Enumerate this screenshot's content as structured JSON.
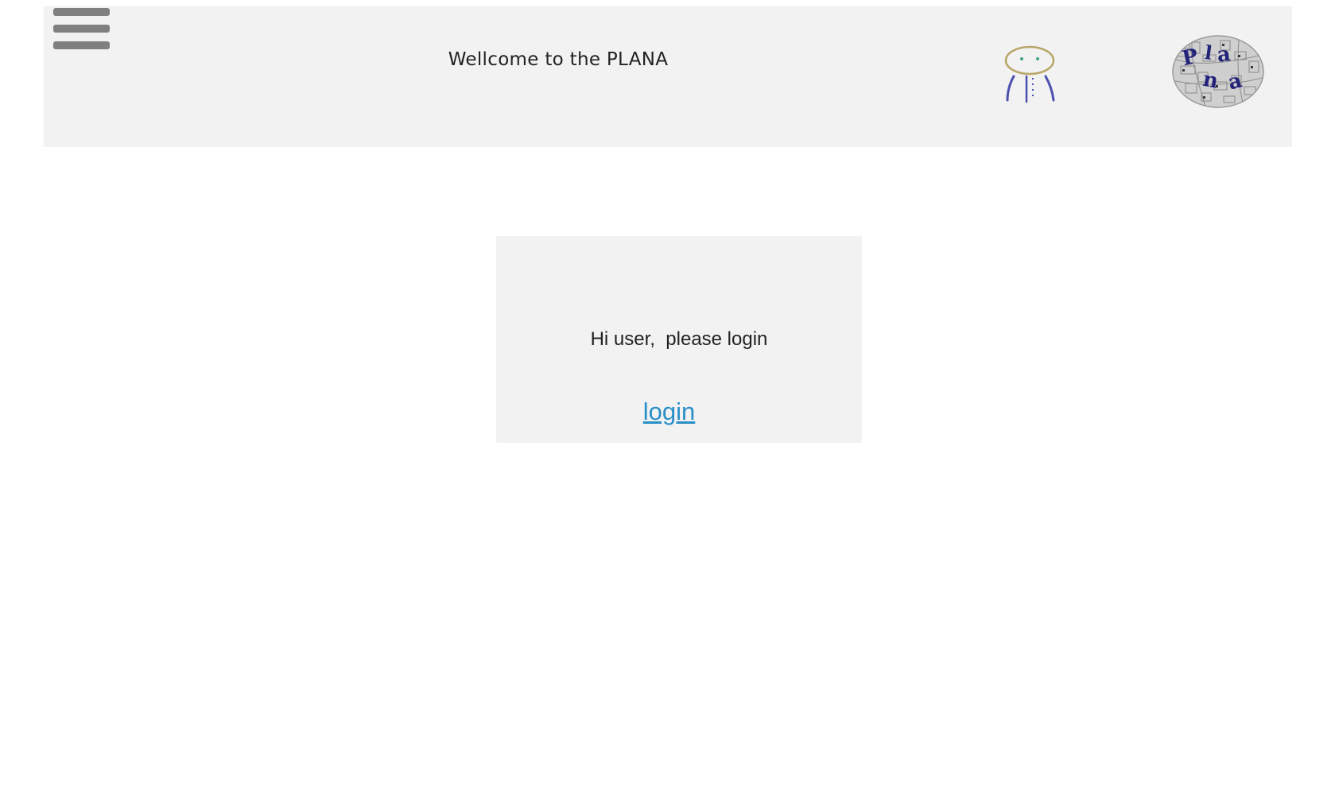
{
  "header": {
    "title": "Wellcome to the PLANA",
    "menu_icon": "hamburger-menu-icon",
    "avatar_icon": "user-avatar-icon",
    "logo_icon": "plana-logo-icon",
    "logo_text": "Plana"
  },
  "login_card": {
    "message": "Hi user,  please login",
    "link_label": "login",
    "link_color": "#2a8fc7"
  },
  "colors": {
    "panel_background": "#f2f2f2",
    "menu_bar": "#808080"
  }
}
